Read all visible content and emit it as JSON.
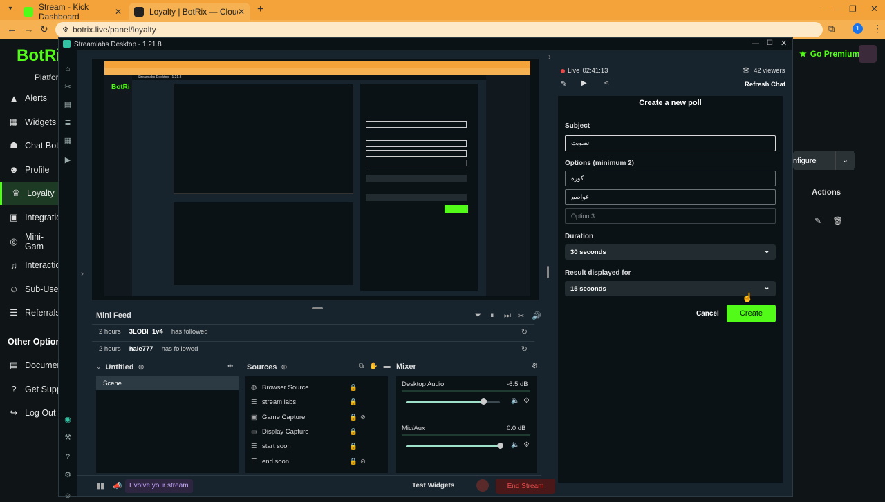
{
  "browser": {
    "tabs": [
      {
        "title": "Stream - Kick Dashboard",
        "favicon_color": "#53fc18"
      },
      {
        "title": "Loyalty | BotRix — Cloud Strean",
        "favicon_color": "#222222"
      }
    ],
    "new_tab": "+",
    "url": "botrix.live/panel/loyalty",
    "profile_initial": "1"
  },
  "botrix": {
    "logo": "BotRi",
    "platform": "Platfor",
    "go_premium": "Go Premium",
    "nav": [
      {
        "label": "Alerts",
        "icon": "alert-icon"
      },
      {
        "label": "Widgets",
        "icon": "grid-icon"
      },
      {
        "label": "Chat Bot",
        "icon": "robot-icon"
      },
      {
        "label": "Profile",
        "icon": "user-icon"
      },
      {
        "label": "Loyalty",
        "icon": "trophy-icon"
      },
      {
        "label": "Integratio",
        "icon": "puzzle-icon"
      },
      {
        "label": "Mini-Gam",
        "icon": "gamepad-icon"
      },
      {
        "label": "Interactio",
        "icon": "music-icon"
      },
      {
        "label": "Sub-User",
        "icon": "user-group-icon"
      },
      {
        "label": "Referrals",
        "icon": "users-icon"
      }
    ],
    "other_options": "Other Options",
    "other_nav": [
      {
        "label": "Documen",
        "icon": "document-icon"
      },
      {
        "label": "Get Supp",
        "icon": "help-icon"
      },
      {
        "label": "Log Out",
        "icon": "logout-icon"
      }
    ],
    "configure": "nfigure",
    "actions": "Actions"
  },
  "streamlabs": {
    "title": "Streamlabs Desktop - 1.21.8",
    "mini_feed": {
      "title": "Mini Feed",
      "events": [
        {
          "time": "2 hours",
          "user": "3LOBI_1v4",
          "action": "has followed"
        },
        {
          "time": "2 hours",
          "user": "haie777",
          "action": "has followed"
        }
      ]
    },
    "scenes": {
      "title": "Untitled",
      "items": [
        "Scene"
      ]
    },
    "sources": {
      "title": "Sources",
      "items": [
        "Browser Source",
        "stream labs",
        "Game Capture",
        "Display Capture",
        "start soon",
        "end soon"
      ]
    },
    "mixer": {
      "title": "Mixer",
      "channels": [
        {
          "name": "Desktop Audio",
          "db": "-6.5 dB",
          "level": 0.82
        },
        {
          "name": "Mic/Aux",
          "db": "0.0 dB",
          "level": 1.0
        }
      ]
    },
    "footer": {
      "evolve": "Evolve your stream",
      "test_widgets": "Test Widgets",
      "end_stream": "End Stream"
    },
    "chat": {
      "live_label": "Live",
      "live_time": "02:41:13",
      "viewers": "42 viewers",
      "refresh_chat": "Refresh Chat"
    },
    "poll": {
      "title": "Create a new poll",
      "subject_label": "Subject",
      "subject_value": "تصويت",
      "options_label": "Options (minimum 2)",
      "options": [
        "كورة",
        "عواصم"
      ],
      "option3_placeholder": "Option 3",
      "duration_label": "Duration",
      "duration_value": "30 seconds",
      "result_label": "Result displayed for",
      "result_value": "15 seconds",
      "cancel": "Cancel",
      "create": "Create"
    },
    "preview": {
      "title": "Streamlabs Desktop - 1.21.8"
    }
  },
  "colors": {
    "accent": "#53fc18",
    "live_dot": "#e94949",
    "end_stream_bg": "#4a1818",
    "chrome_tab": "#f3a33a"
  }
}
